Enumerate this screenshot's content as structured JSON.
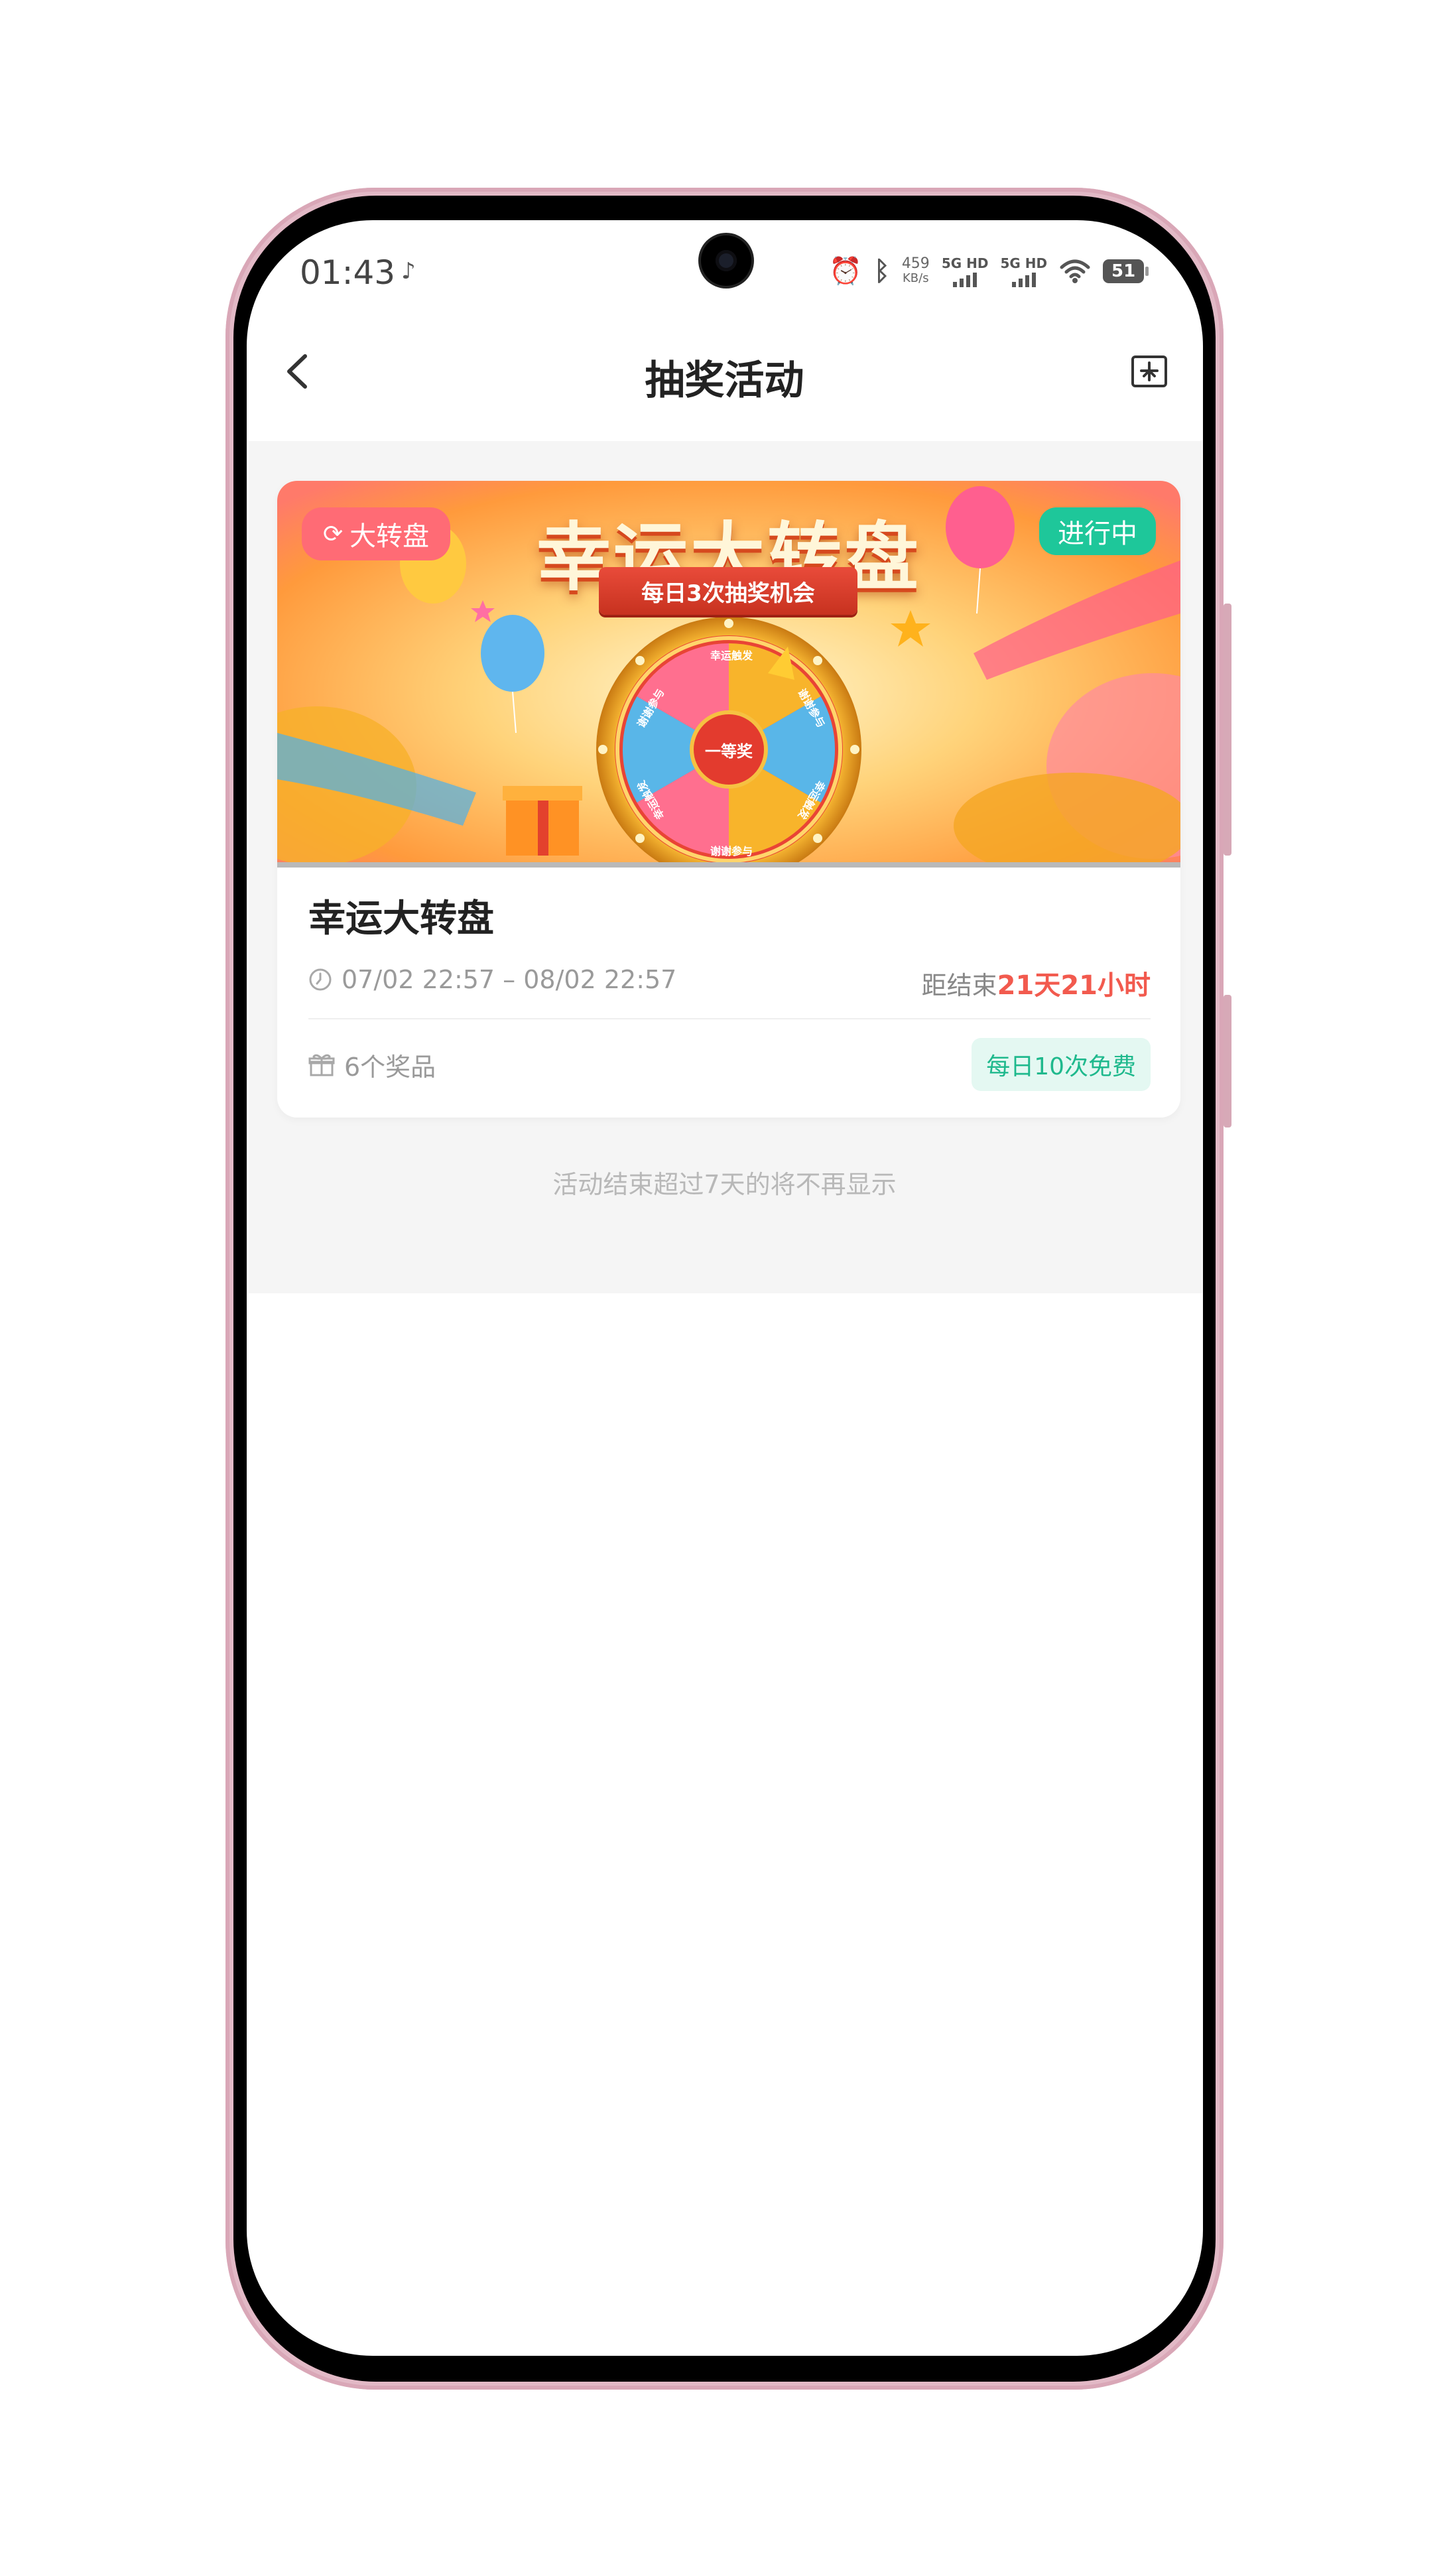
{
  "status_bar": {
    "time": "01:43",
    "net_speed_value": "459",
    "net_speed_unit": "KB/s",
    "sim1_label": "5G HD",
    "sim2_label": "5G HD",
    "battery": "51",
    "icons": [
      "alarm-icon",
      "bluetooth-icon",
      "signal-icon",
      "wifi-icon",
      "battery-icon"
    ]
  },
  "header": {
    "title": "抽奖活动",
    "back_icon": "chevron-left-icon",
    "action_icon": "export-icon"
  },
  "activity_card": {
    "banner": {
      "title": "幸运大转盘",
      "subtitle": "每日3次抽奖机会",
      "wheel_center": "一等奖",
      "segments": [
        "幸运触发",
        "谢谢参与",
        "幸运触发",
        "谢谢参与",
        "幸运触发",
        "谢谢参与"
      ]
    },
    "type_tag": "大转盘",
    "status_tag": "进行中",
    "title": "幸运大转盘",
    "time_range": "07/02 22:57 – 08/02 22:57",
    "countdown_label": "距结束",
    "countdown_value": "21天21小时",
    "prize_count": "6个奖品",
    "free_badge": "每日10次免费"
  },
  "footer_note": "活动结束超过7天的将不再显示",
  "colors": {
    "accent_green": "#1ec79a",
    "accent_red": "#f25a4e",
    "tag_pink": "#ff6b75",
    "frame_pink": "#e2b9c6"
  }
}
